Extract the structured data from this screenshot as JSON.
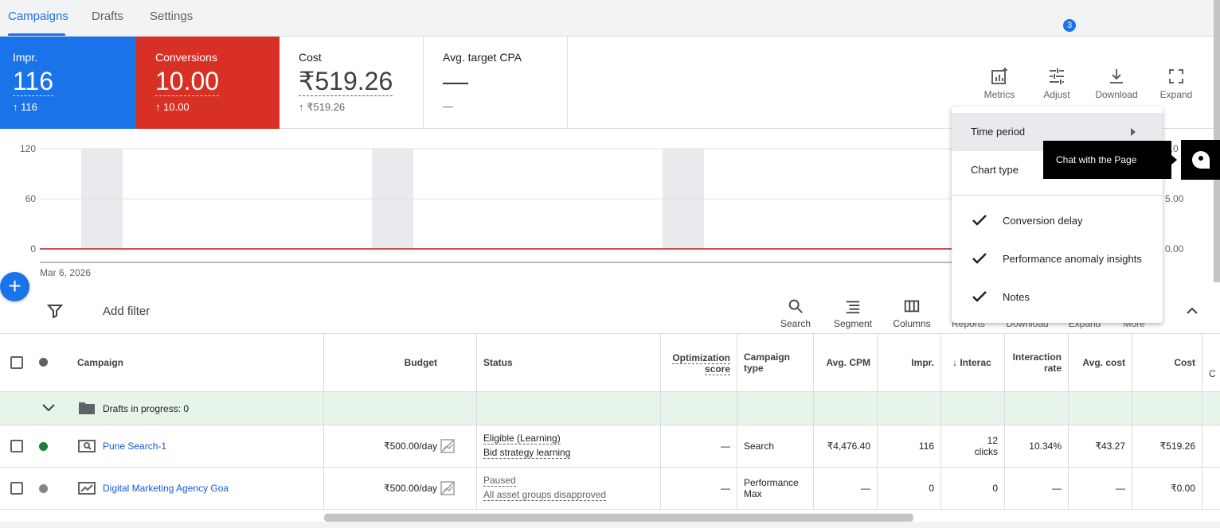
{
  "tabs": [
    {
      "label": "Campaigns"
    },
    {
      "label": "Drafts"
    },
    {
      "label": "Settings"
    }
  ],
  "scorecards": [
    {
      "label": "Impr.",
      "value": "116",
      "delta": "116"
    },
    {
      "label": "Conversions",
      "value": "10.00",
      "delta": "10.00"
    },
    {
      "label": "Cost",
      "value": "₹519.26",
      "delta": "₹519.26"
    },
    {
      "label": "Avg. target CPA",
      "value": "—",
      "delta": "—"
    }
  ],
  "chart_tools": {
    "metrics": "Metrics",
    "adjust": "Adjust",
    "adjust_badge": "3",
    "download": "Download",
    "expand": "Expand"
  },
  "chart_data": {
    "type": "line",
    "y_ticks": [
      "120",
      "60",
      "0"
    ],
    "y2_ticks": [
      "0.0",
      "5.00",
      "0.00"
    ],
    "x_label": "Mar 6, 2026",
    "series_color": "#d93025"
  },
  "filter_bar": {
    "add_filter": "Add filter",
    "tools": [
      "Search",
      "Segment",
      "Columns",
      "Reports",
      "Download",
      "Expand",
      "More"
    ]
  },
  "dropdown": {
    "items": [
      "Time period",
      "Chart type"
    ],
    "checked_items": [
      "Conversion delay",
      "Performance anomaly insights",
      "Notes"
    ]
  },
  "tooltip": "Chat with the Page",
  "table": {
    "headers": {
      "campaign": "Campaign",
      "budget": "Budget",
      "status": "Status",
      "opt_score_1": "Optimization",
      "opt_score_2": "score",
      "type_1": "Campaign",
      "type_2": "type",
      "avg_cpm": "Avg. CPM",
      "impr": "Impr.",
      "interactions": "Interac",
      "rate_1": "Interaction",
      "rate_2": "rate",
      "avg_cost": "Avg. cost",
      "cost": "Cost",
      "extra": "C"
    },
    "drafts_row": "Drafts in progress: 0",
    "rows": [
      {
        "campaign": "Pune Search-1",
        "budget": "₹500.00/day",
        "status_1": "Eligible (Learning)",
        "status_2": "Bid strategy learning",
        "opt_score": "—",
        "type": "Search",
        "avg_cpm": "₹4,476.40",
        "impr": "116",
        "interactions_1": "12",
        "interactions_2": "clicks",
        "rate": "10.34%",
        "avg_cost": "₹43.27",
        "cost": "₹519.26",
        "status_color": "#188038"
      },
      {
        "campaign": "Digital Marketing Agency Goa",
        "budget": "₹500.00/day",
        "status_1": "Paused",
        "status_2": "All asset groups disapproved",
        "opt_score": "—",
        "type_1": "Performance",
        "type_2": "Max",
        "avg_cpm": "—",
        "impr": "0",
        "interactions": "0",
        "rate": "—",
        "avg_cost": "—",
        "cost": "₹0.00",
        "status_color": "#80868b"
      }
    ]
  }
}
